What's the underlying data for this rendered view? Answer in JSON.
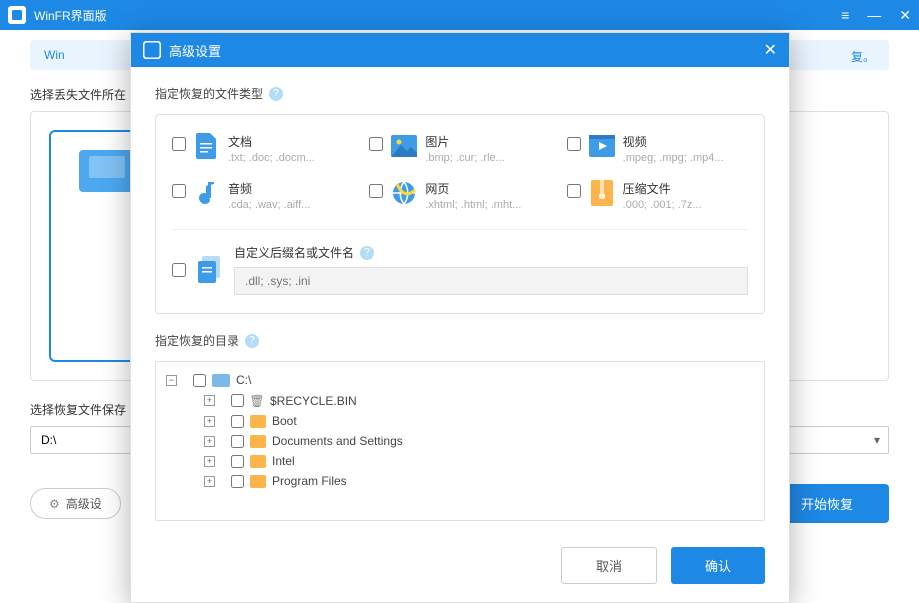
{
  "app": {
    "title": "WinFR界面版"
  },
  "banner": {
    "prefix": "Win",
    "suffix": "复。"
  },
  "main": {
    "select_source_label": "选择丢失文件所在",
    "select_dest_label": "选择恢复文件保存",
    "dest_value": "D:\\",
    "adv_settings_btn": "高级设",
    "start_btn": "开始恢复"
  },
  "modal": {
    "title": "高级设置",
    "section_types": "指定恢复的文件类型",
    "section_dirs": "指定恢复的目录",
    "types": [
      {
        "name": "文档",
        "ext": ".txt; .doc; .docm..."
      },
      {
        "name": "图片",
        "ext": ".bmp; .cur; .rle..."
      },
      {
        "name": "视频",
        "ext": ".mpeg; .mpg; .mp4..."
      },
      {
        "name": "音频",
        "ext": ".cda; .wav; .aiff..."
      },
      {
        "name": "网页",
        "ext": ".xhtml; .html; .mht..."
      },
      {
        "name": "压缩文件",
        "ext": ".000; .001; .7z..."
      }
    ],
    "custom": {
      "label": "自定义后缀名或文件名",
      "placeholder": ".dll; .sys; .ini"
    },
    "tree": {
      "root": "C:\\",
      "children": [
        "$RECYCLE.BIN",
        "Boot",
        "Documents and Settings",
        "Intel",
        "Program Files"
      ]
    },
    "cancel": "取消",
    "ok": "确认"
  }
}
